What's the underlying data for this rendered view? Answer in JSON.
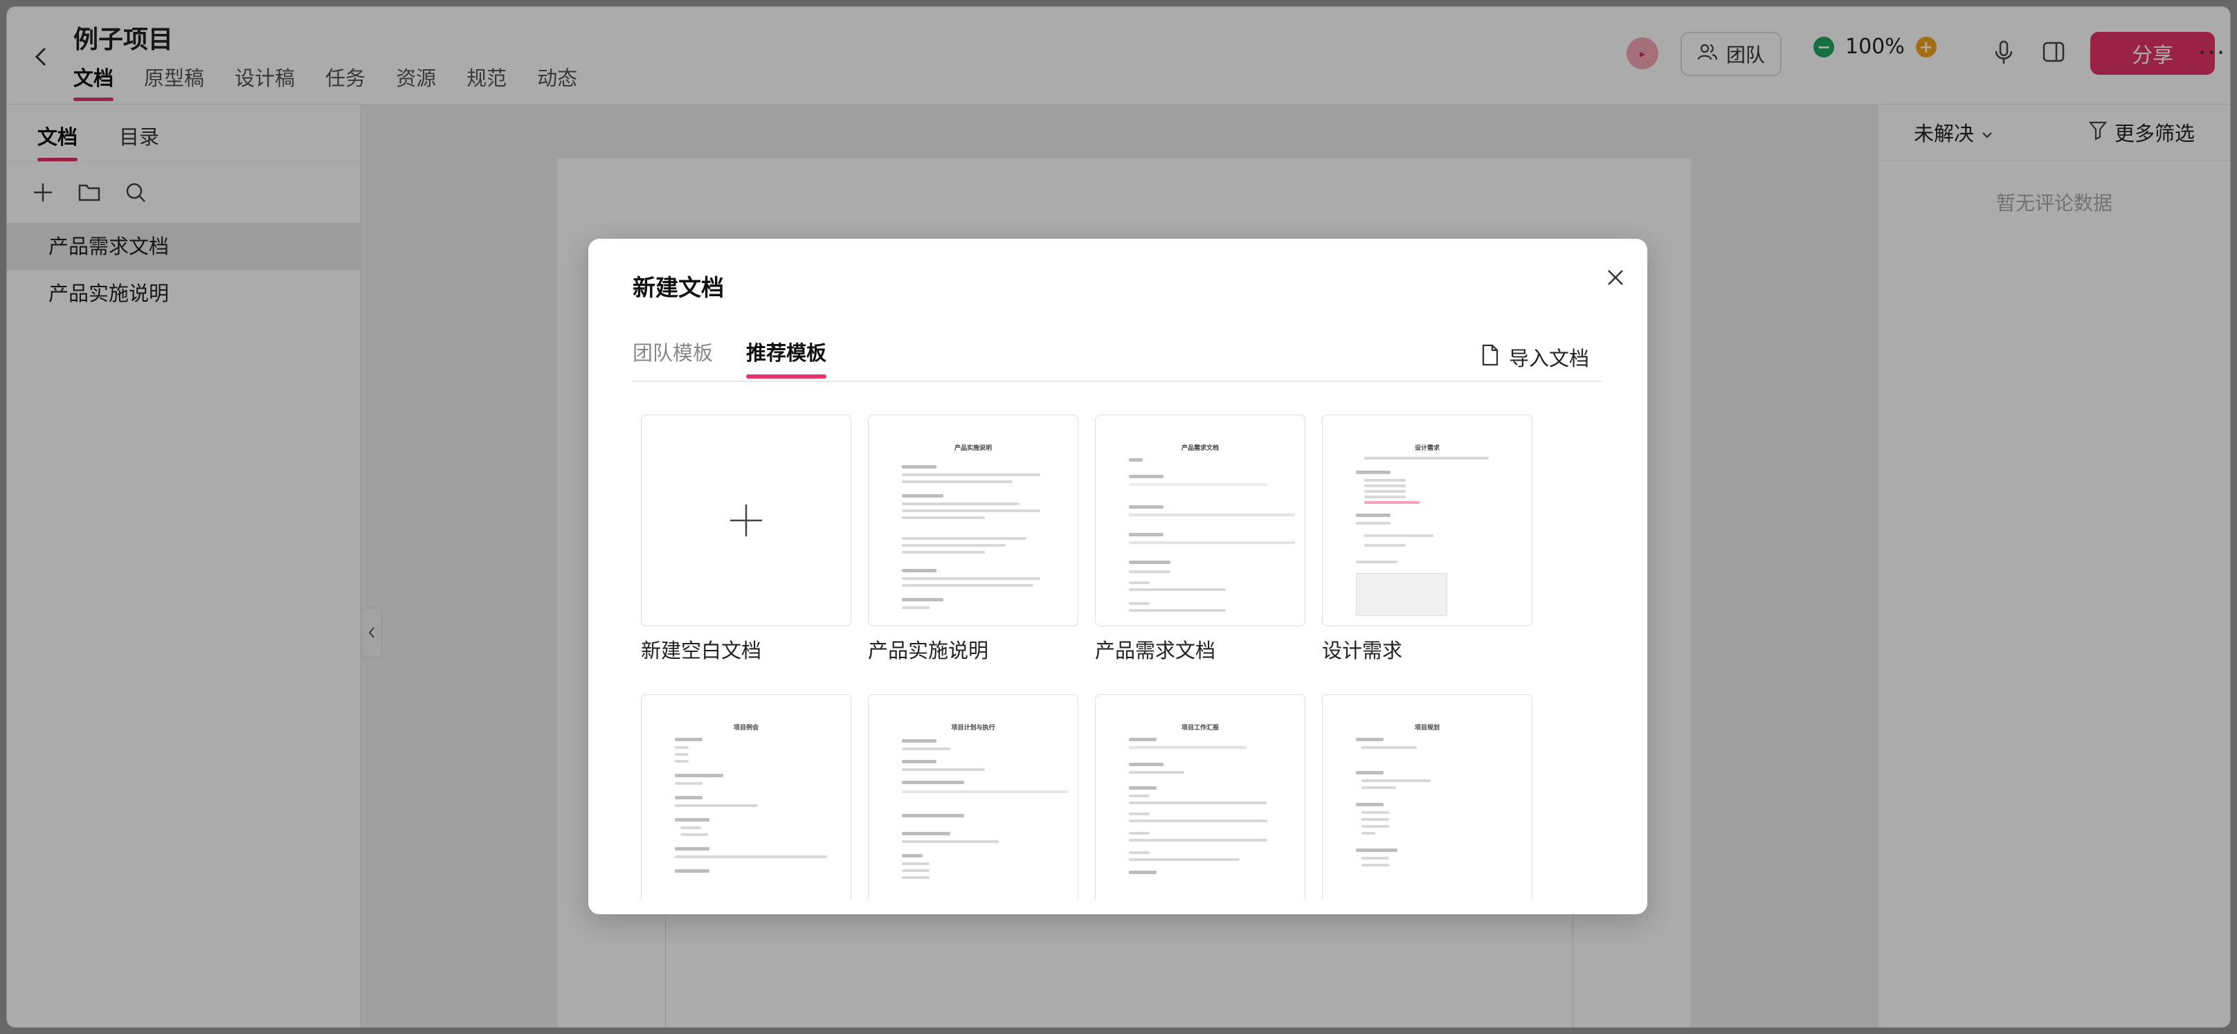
{
  "project": {
    "title": "例子项目"
  },
  "nav": {
    "tabs": [
      "文档",
      "原型稿",
      "设计稿",
      "任务",
      "资源",
      "规范",
      "动态"
    ],
    "active": 0
  },
  "toolbar": {
    "team_label": "团队",
    "zoom": "100%",
    "share_label": "分享",
    "more_label": "···"
  },
  "sidebar": {
    "tabs": [
      "文档",
      "目录"
    ],
    "docs": [
      "产品需求文档",
      "产品实施说明"
    ],
    "selected": 0
  },
  "comments": {
    "filter_label": "未解决",
    "more_filter_label": "更多筛选",
    "empty": "暂无评论数据"
  },
  "modal": {
    "title": "新建文档",
    "tabs": [
      "团队模板",
      "推荐模板"
    ],
    "active_tab": 1,
    "import_label": "导入文档",
    "templates": [
      {
        "label": "新建空白文档",
        "thumb_title": ""
      },
      {
        "label": "产品实施说明",
        "thumb_title": "产品实施说明"
      },
      {
        "label": "产品需求文档",
        "thumb_title": "产品需求文档"
      },
      {
        "label": "设计需求",
        "thumb_title": "设计需求"
      },
      {
        "label": "",
        "thumb_title": "项目例会"
      },
      {
        "label": "",
        "thumb_title": "项目计划与执行"
      },
      {
        "label": "",
        "thumb_title": "项目工作汇报"
      },
      {
        "label": "",
        "thumb_title": "项目规划"
      }
    ]
  },
  "colors": {
    "accent": "#e8336b",
    "zoom_minus": "#22a862",
    "zoom_plus": "#f3a320"
  }
}
